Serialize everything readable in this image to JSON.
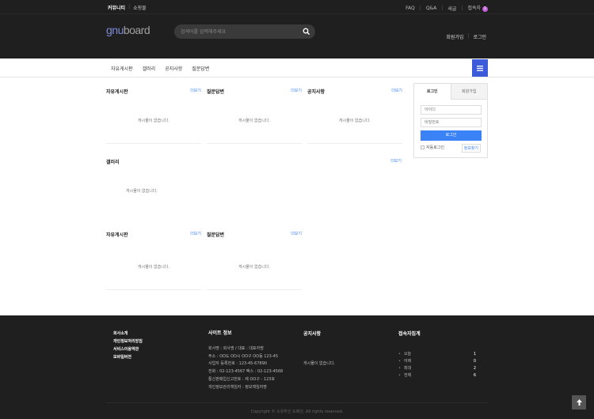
{
  "topbar": {
    "left": [
      "커뮤니티",
      "쇼핑몰"
    ],
    "right": [
      "FAQ",
      "Q&A",
      "새글",
      "접속자"
    ],
    "visitor_count": "1"
  },
  "header": {
    "logo_part1": "gnu",
    "logo_part2": "board",
    "search_placeholder": "검색어를 입력해주세요",
    "links": [
      "회원가입",
      "로그인"
    ]
  },
  "gnb": {
    "items": [
      "자유게시판",
      "갤러리",
      "공지사항",
      "질문답변"
    ]
  },
  "boards": {
    "more_label": "더보기",
    "empty_label": "게시물이 없습니다.",
    "row1": [
      "자유게시판",
      "질문답변",
      "공지사항"
    ],
    "gallery": "갤러리",
    "row3": [
      "자유게시판",
      "질문답변"
    ]
  },
  "login": {
    "tab_login": "로그인",
    "tab_join": "회원가입",
    "id_placeholder": "아이디",
    "pw_placeholder": "비밀번호",
    "button": "로그인",
    "auto_login": "자동로그인",
    "find": "정보찾기"
  },
  "footer": {
    "links": [
      "회사소개",
      "개인정보처리방침",
      "서비스이용약관",
      "모바일버전"
    ],
    "info_title": "사이트 정보",
    "info": [
      "회사명 : 회사명 / 대표 : 대표자명",
      "주소 : OO도 OO시 OO구 OO동 123-45",
      "사업자 등록번호 : 123-45-67890",
      "전화 : 02-123-4567 팩스 : 02-123-4568",
      "통신판매업신고번호 : 제 OO구 - 123호",
      "개인정보관리책임자 : 정보책임자명"
    ],
    "notice_title": "공지사항",
    "notice_empty": "게시물이 없습니다.",
    "stats_title": "접속자집계",
    "stats": [
      {
        "label": "오늘",
        "value": "1"
      },
      {
        "label": "어제",
        "value": "0"
      },
      {
        "label": "최대",
        "value": "2"
      },
      {
        "label": "전체",
        "value": "6"
      }
    ],
    "copyright": "Copyright © 소유하신 도메인. All rights reserved."
  }
}
